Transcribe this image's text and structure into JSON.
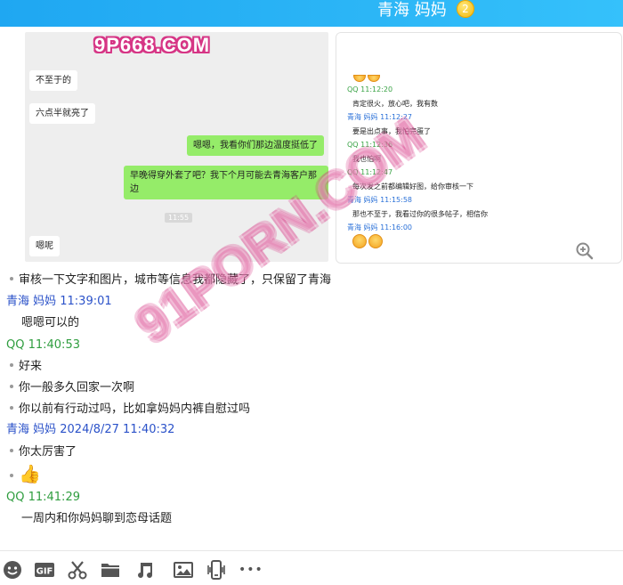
{
  "header": {
    "title": "青海 妈妈",
    "badge": "2"
  },
  "watermarks": {
    "top": "9P668.COM",
    "diagonal": "91PORN.COM"
  },
  "screenshot_left": {
    "messages": [
      {
        "side": "left",
        "text": "不至于的"
      },
      {
        "side": "left",
        "text": "六点半就亮了"
      },
      {
        "side": "right",
        "text": "嗯嗯，我看你们那边温度挺低了"
      },
      {
        "side": "right",
        "text": "早晚得穿外套了吧？我下个月可能去青海客户那边"
      },
      {
        "side": "left",
        "text": "嗯呢"
      }
    ],
    "time_tag": "11:55"
  },
  "screenshot_right": {
    "entries": [
      {
        "who": "QQ 11:12:20",
        "kind": "qq",
        "msg": "肯定很火，放心吧，我有数"
      },
      {
        "who": "青海 妈妈 11:12:27",
        "kind": "mom",
        "msg": "要是出点事，我怕完蛋了"
      },
      {
        "who": "QQ 11:12:36",
        "kind": "qq",
        "msg": "我也怕啊"
      },
      {
        "who": "QQ 11:12:47",
        "kind": "qq",
        "msg": "每次发之前都编辑好图，给你审核一下"
      },
      {
        "who": "青海 妈妈 11:15:58",
        "kind": "mom",
        "msg": "那也不至于，我看过你的很多帖子，相信你"
      },
      {
        "who": "青海 妈妈 11:16:00",
        "kind": "mom",
        "msg": ""
      }
    ]
  },
  "log": {
    "line1": "审核一下文字和图片，城市等信息我都隐藏了，只保留了青海",
    "sender1": "青海 妈妈  11:39:01",
    "msg1": "嗯嗯可以的",
    "sender2": "QQ  11:40:53",
    "msg2a": "好来",
    "msg2b": "你一般多久回家一次啊",
    "msg2c": "你以前有行动过吗，比如拿妈妈内裤自慰过吗",
    "sender3": "青海 妈妈 2024/8/27 11:40:32",
    "msg3a": "你太厉害了",
    "msg3b": "👍",
    "sender4": "QQ  11:41:29",
    "msg4": "一周内和你妈妈聊到恋母话题"
  },
  "toolbar": {
    "icons": [
      "emoji-icon",
      "gif-icon",
      "scissors-icon",
      "folder-icon",
      "music-icon",
      "image-icon",
      "shake-icon",
      "more-icon"
    ],
    "gif_label": "GIF",
    "more_label": "•••"
  },
  "colors": {
    "header": "#2cb6f6",
    "bubble_green": "#95ec69",
    "mom": "#2b52c9",
    "qq": "#2f9d3f"
  }
}
